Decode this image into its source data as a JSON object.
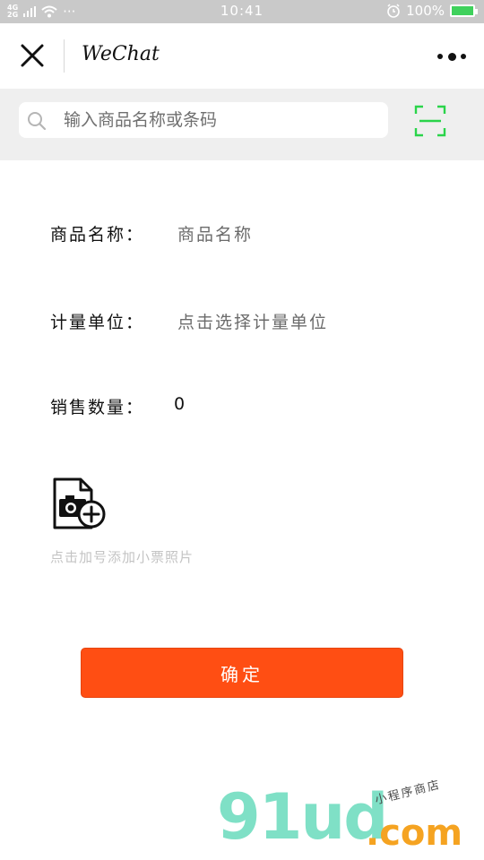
{
  "status_bar": {
    "network_top": "4G",
    "network_bottom": "2G",
    "dots": "···",
    "time": "10:41",
    "battery": "100%"
  },
  "titlebar": {
    "title": "WeChat"
  },
  "search": {
    "placeholder": "输入商品名称或条码"
  },
  "form": {
    "name_label": "商品名称：",
    "name_placeholder": "商品名称",
    "unit_label": "计量单位：",
    "unit_placeholder": "点击选择计量单位",
    "qty_label": "销售数量：",
    "qty_value": "0",
    "photo_hint": "点击加号添加小票照片",
    "confirm_label": "确定"
  },
  "watermark": {
    "brand": "91ud",
    "domain": ".com",
    "tagline": "小程序商店"
  },
  "colors": {
    "accent": "#ff4e13",
    "scan_green": "#2ad44a",
    "watermark_teal": "#7fe0c6",
    "watermark_orange": "#f5a321"
  }
}
